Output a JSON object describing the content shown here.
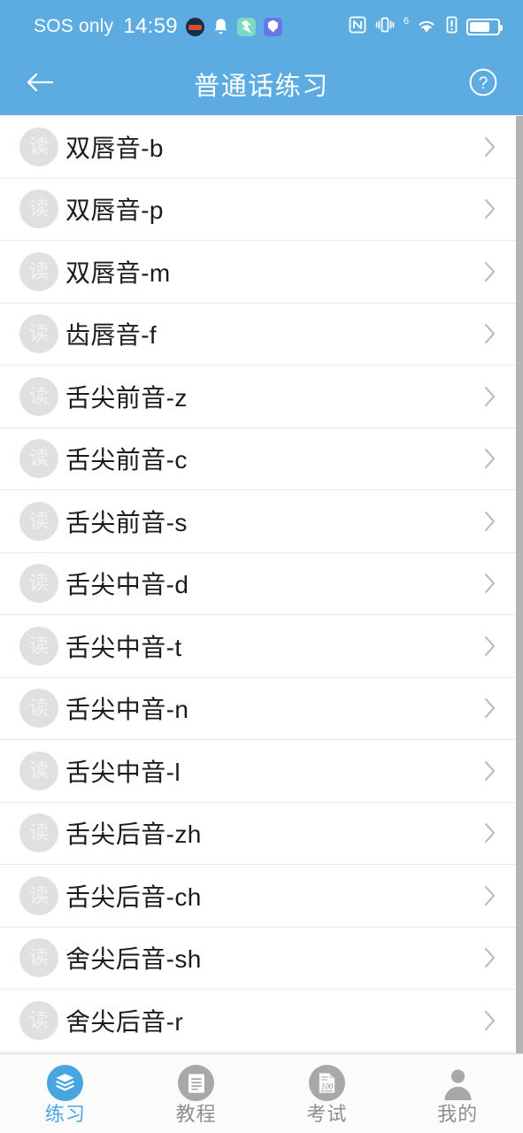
{
  "theme": {
    "accent": "#49A5E0",
    "header_bg": "#5CACE2",
    "badge_bg": "#e0e0e0",
    "inactive_gray": "#a8a8a8",
    "label_gray": "#8f8f8f",
    "divider": "#e9e9e9",
    "scrollbar": "#b4b4b4",
    "row_text": "#1b1b1b"
  },
  "statusbar": {
    "carrier": "SOS only",
    "clock": "14:59",
    "left_icons": [
      "app-badge-dark-icon",
      "bell-icon",
      "app-badge-green-icon",
      "app-badge-blue-icon"
    ],
    "right_icons": [
      "nfc-icon",
      "vibrate-icon",
      "wifi-6-icon",
      "signal-alert-icon",
      "battery-icon"
    ],
    "wifi_generation": "6",
    "battery_level_percent": 72
  },
  "header": {
    "back_icon": "arrow-left-icon",
    "title": "普通话练习",
    "help_icon": "question-circle-icon"
  },
  "list": {
    "badge_text": "读",
    "chevron_icon": "chevron-right-icon",
    "items": [
      {
        "label": "双唇音-b"
      },
      {
        "label": "双唇音-p"
      },
      {
        "label": "双唇音-m"
      },
      {
        "label": "齿唇音-f"
      },
      {
        "label": "舌尖前音-z"
      },
      {
        "label": "舌尖前音-c"
      },
      {
        "label": "舌尖前音-s"
      },
      {
        "label": "舌尖中音-d"
      },
      {
        "label": "舌尖中音-t"
      },
      {
        "label": "舌尖中音-n"
      },
      {
        "label": "舌尖中音-l"
      },
      {
        "label": "舌尖后音-zh"
      },
      {
        "label": "舌尖后音-ch"
      },
      {
        "label": "舍尖后音-sh"
      },
      {
        "label": "舍尖后音-r"
      }
    ]
  },
  "scrollbar": {
    "visible": true
  },
  "tabbar": {
    "tabs": [
      {
        "label": "练习",
        "icon": "layers-icon",
        "active": true
      },
      {
        "label": "教程",
        "icon": "document-lines-icon",
        "active": false
      },
      {
        "label": "考试",
        "icon": "exam-paper-100-icon",
        "active": false
      },
      {
        "label": "我的",
        "icon": "person-icon",
        "active": false
      }
    ]
  }
}
